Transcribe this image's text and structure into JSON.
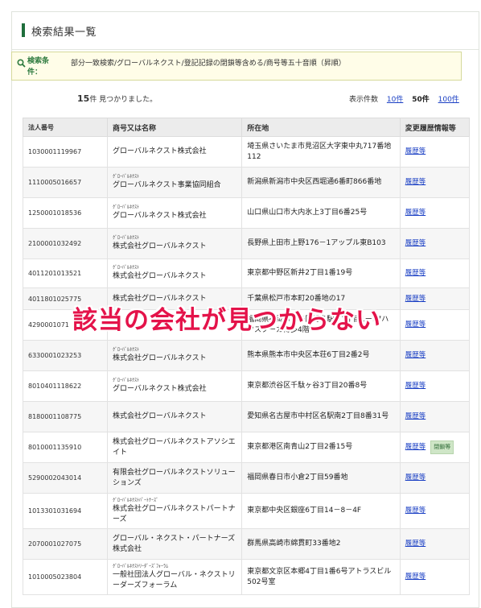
{
  "panel": {
    "title": "検索結果一覧"
  },
  "conditions": {
    "label": "検索条件：",
    "text": "部分一致検索/グローバルネクスト/登記記録の閉鎖等含める/商号等五十音順（昇順）"
  },
  "results": {
    "count": "15",
    "count_suffix": "件 見つかりました。",
    "per_page_label": "表示件数",
    "per_page_options": [
      "10件",
      "50件",
      "100件"
    ],
    "per_page_selected": "50件"
  },
  "table": {
    "headers": [
      "法人番号",
      "商号又は名称",
      "所在地",
      "変更履歴情報等"
    ],
    "rows": [
      {
        "num": "1030001119967",
        "kana": "",
        "name": "グローバルネクスト株式会社",
        "addr": "埼玉県さいたま市見沼区大字東中丸717番地112",
        "hist": "履歴等",
        "closed": ""
      },
      {
        "num": "1110005016657",
        "kana": "ｸﾞﾛｰﾊﾞﾙﾈｸｽﾄ",
        "name": "グローバルネクスト事業協同組合",
        "addr": "新潟県新潟市中央区西堀通6番町866番地",
        "hist": "履歴等",
        "closed": ""
      },
      {
        "num": "1250001018536",
        "kana": "ｸﾞﾛｰﾊﾞﾙﾈｸｽﾄ",
        "name": "グローバルネクスト株式会社",
        "addr": "山口県山口市大内氷上3丁目6番25号",
        "hist": "履歴等",
        "closed": ""
      },
      {
        "num": "2100001032492",
        "kana": "ｸﾞﾛｰﾊﾞﾙﾈｸｽﾄ",
        "name": "株式会社グローバルネクスト",
        "addr": "長野県上田市上野176－1アップル東B103",
        "hist": "履歴等",
        "closed": ""
      },
      {
        "num": "4011201013521",
        "kana": "ｸﾞﾛｰﾊﾞﾙﾈｸｽﾄ",
        "name": "株式会社グローバルネクスト",
        "addr": "東京都中野区新井2丁目1番19号",
        "hist": "履歴等",
        "closed": ""
      },
      {
        "num": "4011801025775",
        "kana": "",
        "name": "株式会社グローバルネクスト",
        "addr": "千葉県松戸市本町20番地の17",
        "hist": "履歴等",
        "closed": ""
      },
      {
        "num": "4290001071",
        "kana": "",
        "name": "",
        "addr": "福岡県福岡市博多区博多駅東1丁目1ー17ハクスクーカ博多4階",
        "hist": "履歴等",
        "closed": ""
      },
      {
        "num": "6330001023253",
        "kana": "ｸﾞﾛｰﾊﾞﾙﾈｸｽﾄ",
        "name": "株式会社グローバルネクスト",
        "addr": "熊本県熊本市中央区本荘6丁目2番2号",
        "hist": "履歴等",
        "closed": ""
      },
      {
        "num": "8010401118622",
        "kana": "ｸﾞﾛｰﾊﾞﾙﾈｸｽﾄ",
        "name": "グローバルネクスト株式会社",
        "addr": "東京都渋谷区千駄ヶ谷3丁目20番8号",
        "hist": "履歴等",
        "closed": ""
      },
      {
        "num": "8180001108775",
        "kana": "",
        "name": "株式会社グローバルネクスト",
        "addr": "愛知県名古屋市中村区名駅南2丁目8番31号",
        "hist": "履歴等",
        "closed": ""
      },
      {
        "num": "8010001135910",
        "kana": "",
        "name": "株式会社グローバルネクストアソシエイト",
        "addr": "東京都港区南青山2丁目2番15号",
        "hist": "履歴等",
        "closed": "閉鎖等"
      },
      {
        "num": "5290002043014",
        "kana": "",
        "name": "有限会社グローバルネクストソリューションズ",
        "addr": "福岡県春日市小倉2丁目59番地",
        "hist": "履歴等",
        "closed": ""
      },
      {
        "num": "1013301031694",
        "kana": "ｸﾞﾛｰﾊﾞﾙﾈｸｽﾄﾊﾟｰﾄﾅｰｽﾞ",
        "name": "株式会社グローバルネクストパートナーズ",
        "addr": "東京都中央区銀座6丁目14－8－4F",
        "hist": "履歴等",
        "closed": ""
      },
      {
        "num": "2070001027075",
        "kana": "",
        "name": "グローバル・ネクスト・パートナーズ株式会社",
        "addr": "群馬県高崎市綿貫町33番地2",
        "hist": "履歴等",
        "closed": ""
      },
      {
        "num": "1010005023804",
        "kana": "ｸﾞﾛｰﾊﾞﾙﾈｸｽﾄﾘｰﾀﾞｰｽﾞﾌｫｰﾗﾑ",
        "name": "一般社団法人グローバル・ネクストリーダーズフォーラム",
        "addr": "東京都文京区本郷4丁目1番6号アトラスビル502号室",
        "hist": "履歴等",
        "closed": ""
      }
    ]
  },
  "overlay": {
    "text": "該当の会社が見つからない"
  },
  "colors": {
    "accent": "#1f6e3c",
    "link": "#1a3fc4",
    "overlay": "#e4134a"
  }
}
